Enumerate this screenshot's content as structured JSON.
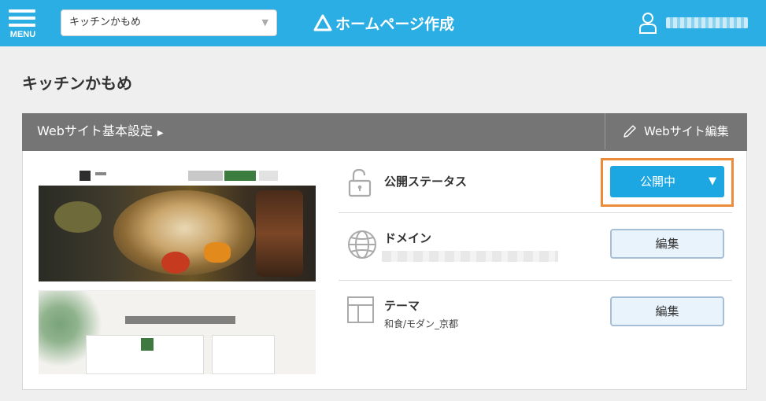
{
  "header": {
    "menu_label": "MENU",
    "site_select": {
      "value": "キッチンかもめ"
    },
    "brand_title": "ホームページ作成",
    "user_name": ""
  },
  "page": {
    "title": "キッチンかもめ"
  },
  "panel": {
    "header_title": "Webサイト基本設定",
    "header_arrow": "▶",
    "edit_website_label": "Webサイト編集"
  },
  "settings": {
    "publish": {
      "label": "公開ステータス",
      "value": "公開中",
      "arrow": "▼"
    },
    "domain": {
      "label": "ドメイン",
      "value": "",
      "button": "編集"
    },
    "theme": {
      "label": "テーマ",
      "value": "和食/モダン_京都",
      "button": "編集"
    }
  },
  "colors": {
    "header_bg": "#2aaee3",
    "panel_head_bg": "#757575",
    "status_button": "#1da7e2",
    "highlight_border": "#ec8b38",
    "edit_button_bg": "#e9f3fb"
  },
  "icons": {
    "menu": "hamburger-icon",
    "brand": "triangle-logo-icon",
    "user": "user-icon",
    "edit": "pencil-icon",
    "publish": "lock-icon",
    "domain": "globe-icon",
    "theme": "layout-icon"
  }
}
